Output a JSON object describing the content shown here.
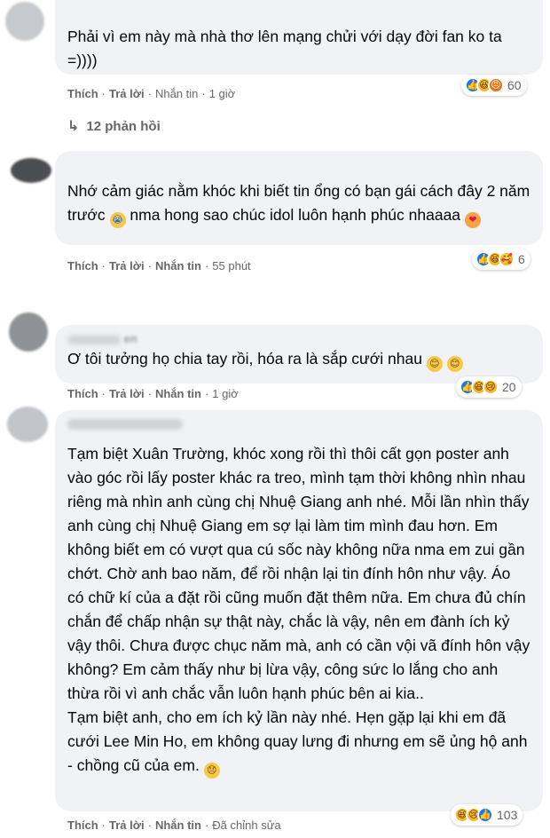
{
  "comments": [
    {
      "text": "Phải vì em này mà nhà thơ lên mạng chửi với dạy đời fan ko ta =))))",
      "actions": {
        "like": "Thích",
        "reply": "Trả lời",
        "message": "Nhắn tin",
        "time": "1 giờ"
      },
      "reaction_count": "60",
      "reactions": [
        "like",
        "haha",
        "angry"
      ]
    },
    {
      "text": "Nhớ cảm giác nằm khóc khi biết tin ổng có bạn gái cách đây 2 năm trước",
      "text_b": "nma hong sao chúc idol luôn hạnh phúc nhaaaa",
      "actions": {
        "like": "Thích",
        "reply": "Trả lời",
        "message": "Nhắn tin",
        "time": "55 phút"
      },
      "reaction_count": "6",
      "reactions": [
        "like",
        "haha",
        "wow"
      ]
    },
    {
      "name": "en",
      "text": "Ơ tôi tưởng họ chia tay rồi, hóa ra là sắp cưới nhau",
      "actions": {
        "like": "Thích",
        "reply": "Trả lời",
        "message": "Nhắn tin",
        "time": "1 giờ"
      },
      "reaction_count": "20",
      "reactions": [
        "like",
        "haha",
        "sad"
      ]
    },
    {
      "text": "Tạm biệt Xuân Trường, khóc xong rồi thì thôi cất gọn poster anh vào góc rồi lấy poster khác ra treo, mình tạm thời không nhìn nhau riêng mà nhìn anh cùng chị Nhuệ Giang anh nhé. Mỗi lần nhìn thấy anh cùng chị Nhuệ Giang em sợ lại làm tim mình đau hơn. Em không biết em có vượt qua cú sốc này không nữa nma em zui gần chớt. Chờ anh bao năm, để rồi nhận lại tin đính hôn như vậy. Áo có chữ kí của a đặt rồi cũng muốn đặt thêm nữa. Em chưa đủ chín chắn để chấp nhận sự thật này, chắc là vậy, nên em đành ích kỷ vậy thôi. Chưa được chục năm mà, anh có cần vội vã đính hôn vậy không? Em cảm thấy như bị lừa vậy, công sức lo lắng cho anh thừa rồi vì anh chắc vẫn luôn hạnh phúc bên ai kia..",
      "text_b": "Tạm biệt anh, cho em ích kỷ lần này nhé. Hẹn gặp lại khi em đã cưới Lee Min Ho, em không quay lưng đi nhưng em sẽ ủng hộ anh - chồng cũ của em.",
      "actions": {
        "like": "Thích",
        "reply": "Trả lời",
        "message": "Nhắn tin",
        "edited": "Đã chỉnh sửa"
      },
      "reaction_count": "103",
      "reactions": [
        "haha",
        "sad",
        "like"
      ]
    }
  ],
  "replies_label": "12 phản hồi",
  "dot": "·"
}
